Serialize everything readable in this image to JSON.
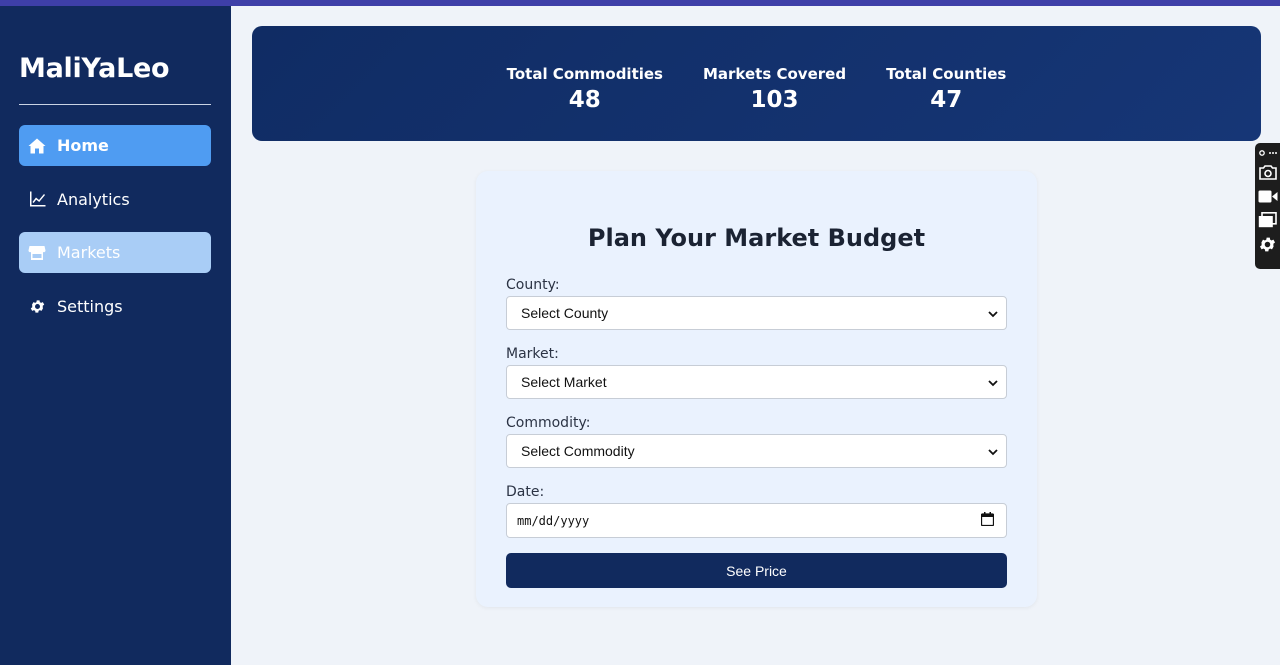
{
  "app": {
    "brand": "MaliYaLeo"
  },
  "sidebar": {
    "items": [
      {
        "label": "Home",
        "icon": "home-icon",
        "state": "active"
      },
      {
        "label": "Analytics",
        "icon": "chart-line-icon",
        "state": "normal"
      },
      {
        "label": "Markets",
        "icon": "store-icon",
        "state": "hover"
      },
      {
        "label": "Settings",
        "icon": "gear-icon",
        "state": "normal"
      }
    ]
  },
  "stats": [
    {
      "label": "Total Commodities",
      "value": "48"
    },
    {
      "label": "Markets Covered",
      "value": "103"
    },
    {
      "label": "Total Counties",
      "value": "47"
    }
  ],
  "form": {
    "title": "Plan Your Market Budget",
    "county": {
      "label": "County:",
      "value": "Select County"
    },
    "market": {
      "label": "Market:",
      "value": "Select Market"
    },
    "commodity": {
      "label": "Commodity:",
      "value": "Select Commodity"
    },
    "date": {
      "label": "Date:",
      "placeholder": "mm/dd/yyyy"
    },
    "submit_label": "See Price"
  },
  "tools": [
    "link-icon",
    "camera-icon",
    "video-icon",
    "windows-icon",
    "gear-icon"
  ],
  "colors": {
    "sidebar_bg": "#112a5e",
    "active_nav": "#4f9cf2",
    "hover_nav": "#a9cdf6",
    "stats_bg": "#102c64",
    "button_bg": "#112a5e",
    "page_bg": "#eff3f9"
  }
}
